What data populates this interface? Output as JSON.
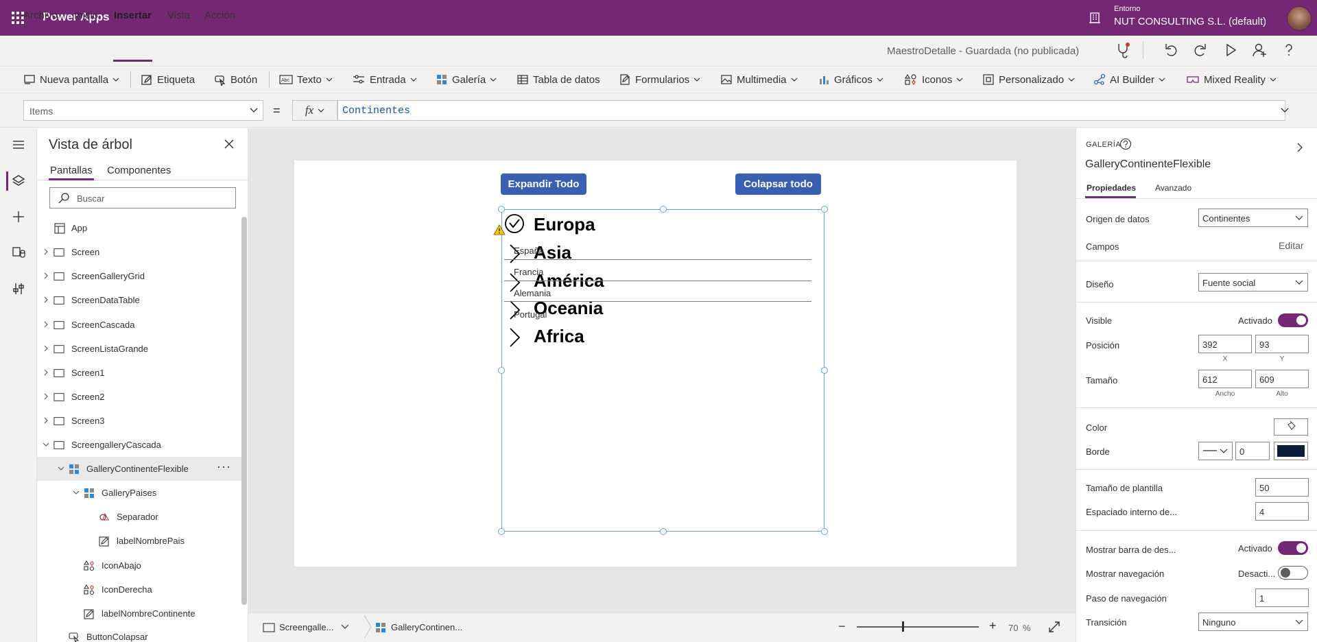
{
  "title_bar": {
    "app_name": "Power Apps",
    "environment_label": "Entorno",
    "environment_name": "NUT CONSULTING S.L. (default)"
  },
  "menu": {
    "items": [
      "Archivo",
      "Inicio",
      "Insertar",
      "Vista",
      "Acción"
    ],
    "active": "Insertar",
    "document_status": "MaestroDetalle - Guardada (no publicada)"
  },
  "ribbon": {
    "items": [
      "Nueva pantalla",
      "Etiqueta",
      "Botón",
      "Texto",
      "Entrada",
      "Galería",
      "Tabla de datos",
      "Formularios",
      "Multimedia",
      "Gráficos",
      "Iconos",
      "Personalizado",
      "AI Builder",
      "Mixed Reality"
    ]
  },
  "formula_bar": {
    "property": "Items",
    "equals": "=",
    "fx": "fx",
    "formula": "Continentes"
  },
  "tree": {
    "title": "Vista de árbol",
    "tabs": [
      "Pantallas",
      "Componentes"
    ],
    "search_placeholder": "Buscar",
    "items": [
      {
        "label": "App"
      },
      {
        "label": "Screen"
      },
      {
        "label": "ScreenGalleryGrid"
      },
      {
        "label": "ScreenDataTable"
      },
      {
        "label": "ScreenCascada"
      },
      {
        "label": "ScreenListaGrande"
      },
      {
        "label": "Screen1"
      },
      {
        "label": "Screen2"
      },
      {
        "label": "Screen3"
      },
      {
        "label": "ScreengalleryCascada"
      },
      {
        "label": "GalleryContinenteFlexible"
      },
      {
        "label": "GalleryPaises"
      },
      {
        "label": "Separador"
      },
      {
        "label": "labelNombrePais"
      },
      {
        "label": "IconAbajo"
      },
      {
        "label": "IconDerecha"
      },
      {
        "label": "labelNombreContinente"
      },
      {
        "label": "ButtonColapsar"
      }
    ],
    "more": "···"
  },
  "canvas": {
    "button_expand": "Expandir Todo",
    "button_collapse": "Colapsar todo",
    "continents": [
      "Europa",
      "Asia",
      "América",
      "Oceania",
      "Africa"
    ],
    "countries": [
      "España",
      "Francia",
      "Alemania",
      "Portugal"
    ]
  },
  "status_bar": {
    "screen_tab": "Screengalle...",
    "gallery_tab": "GalleryContinen...",
    "zoom_value": "70",
    "zoom_unit": "%",
    "zoom_level": 0.37
  },
  "properties": {
    "control_type": "GALERÍA",
    "control_name": "GalleryContinenteFlexible",
    "tabs": [
      "Propiedades",
      "Avanzado"
    ],
    "data_source_label": "Origen de datos",
    "data_source_value": "Continentes",
    "fields_label": "Campos",
    "fields_edit": "Editar",
    "layout_label": "Diseño",
    "layout_value": "Fuente social",
    "visible_label": "Visible",
    "visible_state": "Activado",
    "position_label": "Posición",
    "position_x": "392",
    "position_y": "93",
    "x_label": "X",
    "y_label": "Y",
    "size_label": "Tamaño",
    "size_width": "612",
    "size_height": "609",
    "width_label": "Ancho",
    "height_label": "Alto",
    "color_label": "Color",
    "border_label": "Borde",
    "border_width": "0",
    "template_size_label": "Tamaño de plantilla",
    "template_size_value": "50",
    "padding_label": "Espaciado interno de...",
    "padding_value": "4",
    "scrollbar_label": "Mostrar barra de des...",
    "scrollbar_state": "Activado",
    "navigation_label": "Mostrar navegación",
    "navigation_state": "Desacti...",
    "nav_step_label": "Paso de navegación",
    "nav_step_value": "1",
    "transition_label": "Transición",
    "transition_value": "Ninguno",
    "colors": {
      "accent": "#742774",
      "border_swatch": "#0b1d3a",
      "button": "#3860b2"
    }
  }
}
